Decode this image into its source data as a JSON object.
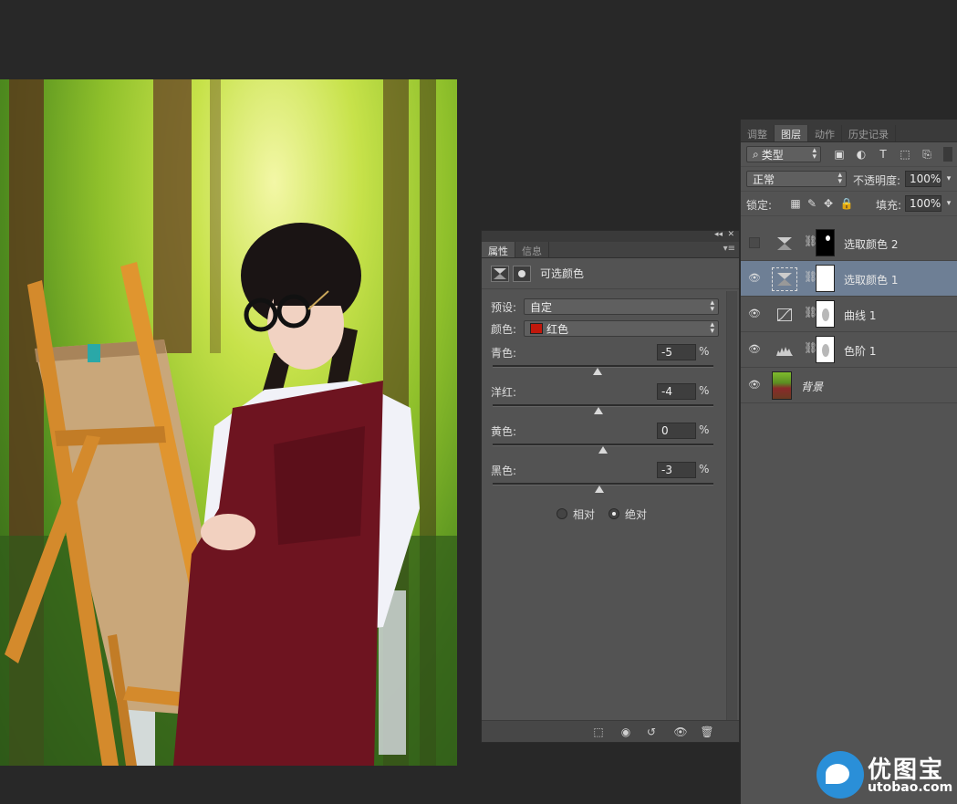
{
  "properties_panel": {
    "tabs": [
      {
        "label": "属性"
      },
      {
        "label": "信息"
      }
    ],
    "collapse_glyph": "◂◂",
    "close_glyph": "✕",
    "menu_glyph": "▾≡",
    "title": "可选颜色",
    "preset_label": "预设:",
    "preset_value": "自定",
    "color_label": "颜色:",
    "color_value": "红色",
    "color_swatch": "#c1180c",
    "sliders": [
      {
        "label": "青色:",
        "value": "-5",
        "unit": "%",
        "percent": -5
      },
      {
        "label": "洋红:",
        "value": "-4",
        "unit": "%",
        "percent": -4
      },
      {
        "label": "黄色:",
        "value": "0",
        "unit": "%",
        "percent": 0
      },
      {
        "label": "黑色:",
        "value": "-3",
        "unit": "%",
        "percent": -3
      }
    ],
    "mode_relative": "相对",
    "mode_absolute": "绝对",
    "mode_selected": "绝对"
  },
  "layers_panel": {
    "tabs": [
      {
        "label": "调整"
      },
      {
        "label": "图层"
      },
      {
        "label": "动作"
      },
      {
        "label": "历史记录"
      }
    ],
    "active_tab": "图层",
    "filter_kind": "类型",
    "blend_mode": "正常",
    "opacity_label": "不透明度:",
    "opacity_value": "100%",
    "lock_label": "锁定:",
    "fill_label": "填充:",
    "fill_value": "100%",
    "layers": [
      {
        "name": "选取颜色 2",
        "visible": false,
        "selected": false
      },
      {
        "name": "选取颜色 1",
        "visible": true,
        "selected": true
      },
      {
        "name": "曲线 1",
        "visible": true,
        "selected": false
      },
      {
        "name": "色阶 1",
        "visible": true,
        "selected": false
      },
      {
        "name": "背景",
        "visible": true,
        "selected": false
      }
    ]
  },
  "watermark": {
    "cn": "优图宝",
    "en": "utobao.com"
  },
  "colors": {
    "app_bg": "#282828",
    "panel": "#535353",
    "selection": "#6e7f95"
  }
}
